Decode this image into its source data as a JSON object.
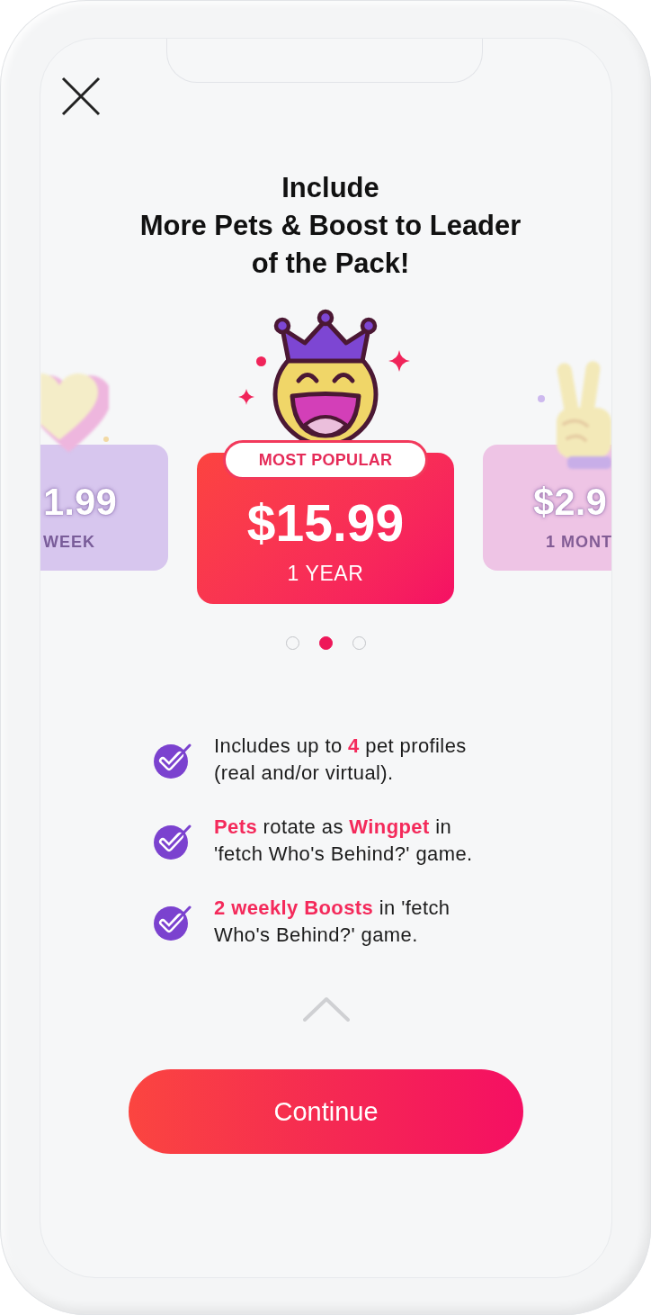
{
  "title": "Include\nMore Pets & Boost to Leader\nof the Pack!",
  "plans": [
    {
      "kind": "heart",
      "price": "1.99",
      "period": "WEEK",
      "color": "#d7c6ee",
      "selected": false
    },
    {
      "kind": "crown",
      "badge": "MOST POPULAR",
      "price": "$15.99",
      "period": "1 YEAR",
      "color": "#f50f64",
      "selected": true
    },
    {
      "kind": "peace",
      "price": "$2.9",
      "period": "1 MONT",
      "color": "#eec4e5",
      "selected": false
    }
  ],
  "pager": [
    {
      "selected": false
    },
    {
      "selected": true
    },
    {
      "selected": false
    }
  ],
  "features": [
    "Includes up to **4** pet profiles\n(real and/or virtual).",
    "**Pets** rotate as **Wingpet** in\n'fetch Who's Behind?' game.",
    "**2 weekly Boosts** in 'fetch\nWho's Behind?' game."
  ],
  "continue_button": {
    "label": "Continue"
  }
}
